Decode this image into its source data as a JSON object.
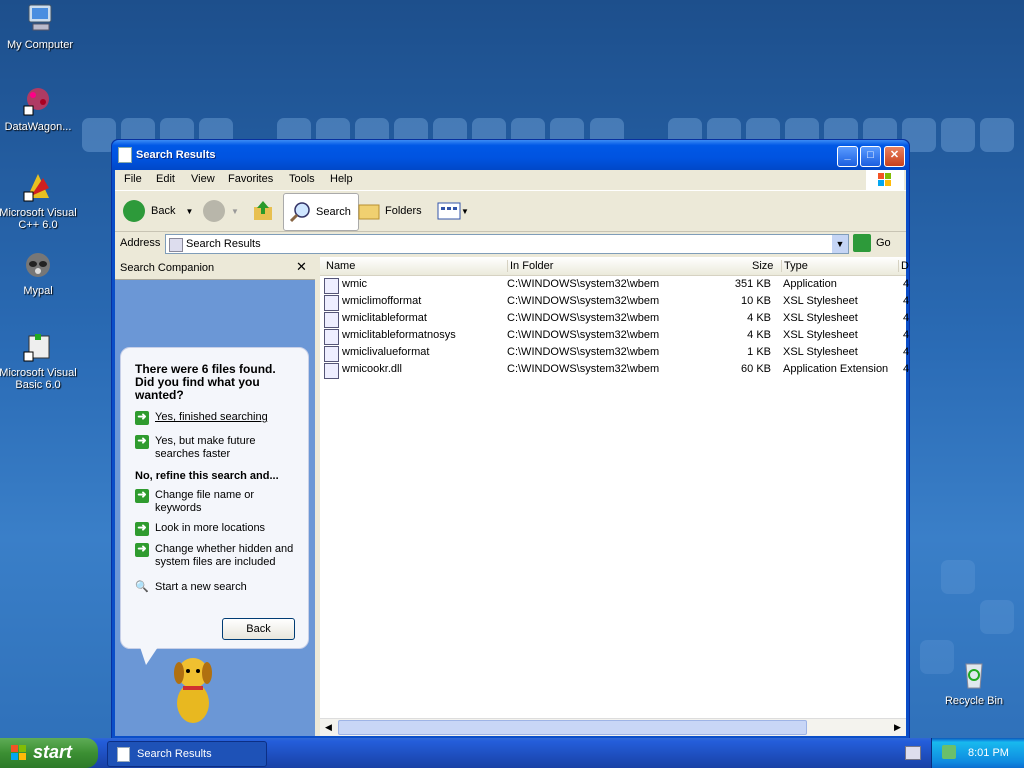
{
  "desktop": {
    "icons": [
      {
        "label": "My Computer"
      },
      {
        "label": "DataWagon..."
      },
      {
        "label": "Microsoft Visual C++ 6.0"
      },
      {
        "label": "Mypal"
      },
      {
        "label": "Microsoft Visual Basic 6.0"
      },
      {
        "label": "Recycle Bin"
      }
    ]
  },
  "window": {
    "title": "Search Results",
    "menu": [
      "File",
      "Edit",
      "View",
      "Favorites",
      "Tools",
      "Help"
    ],
    "toolbar": {
      "back": "Back",
      "search": "Search",
      "folders": "Folders"
    },
    "address": {
      "label": "Address",
      "value": "Search Results",
      "go": "Go"
    }
  },
  "companion": {
    "title": "Search Companion",
    "found_text": "There were 6 files found. Did you find what you wanted?",
    "options": [
      "Yes, finished searching",
      "Yes, but make future searches faster"
    ],
    "refine_heading": "No, refine this search and...",
    "refine_options": [
      "Change file name or keywords",
      "Look in more locations",
      "Change whether hidden and system files are included"
    ],
    "new_search": "Start a new search",
    "back_button": "Back"
  },
  "results": {
    "columns": [
      "Name",
      "In Folder",
      "Size",
      "Type",
      "D"
    ],
    "rows": [
      {
        "name": "wmic",
        "folder": "C:\\WINDOWS\\system32\\wbem",
        "size": "351 KB",
        "type": "Application",
        "d": "4"
      },
      {
        "name": "wmiclimofformat",
        "folder": "C:\\WINDOWS\\system32\\wbem",
        "size": "10 KB",
        "type": "XSL Stylesheet",
        "d": "4"
      },
      {
        "name": "wmiclitableformat",
        "folder": "C:\\WINDOWS\\system32\\wbem",
        "size": "4 KB",
        "type": "XSL Stylesheet",
        "d": "4"
      },
      {
        "name": "wmiclitableformatnosys",
        "folder": "C:\\WINDOWS\\system32\\wbem",
        "size": "4 KB",
        "type": "XSL Stylesheet",
        "d": "4"
      },
      {
        "name": "wmiclivalueformat",
        "folder": "C:\\WINDOWS\\system32\\wbem",
        "size": "1 KB",
        "type": "XSL Stylesheet",
        "d": "4"
      },
      {
        "name": "wmicookr.dll",
        "folder": "C:\\WINDOWS\\system32\\wbem",
        "size": "60 KB",
        "type": "Application Extension",
        "d": "4"
      }
    ]
  },
  "taskbar": {
    "start": "start",
    "task": "Search Results",
    "clock": "8:01 PM"
  }
}
